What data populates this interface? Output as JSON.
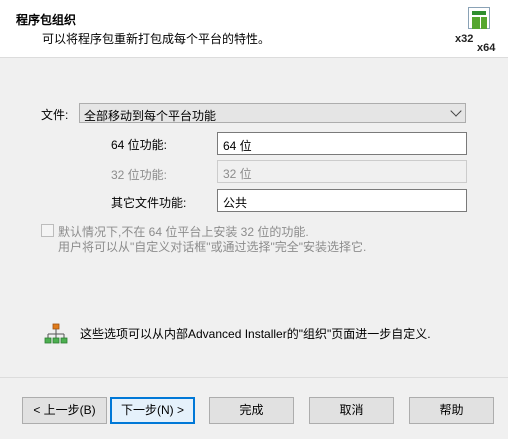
{
  "header": {
    "title": "程序包组织",
    "subtitle": "可以将程序包重新打包成每个平台的特性。",
    "logo_label_32": "x32",
    "logo_label_64": "x64"
  },
  "form": {
    "file_label": "文件:",
    "file_select_value": "全部移动到每个平台功能",
    "f64_label": "64 位功能:",
    "f64_value": "64 位",
    "f32_label": "32 位功能:",
    "f32_value": "32 位",
    "other_label": "其它文件功能:",
    "other_value": "公共"
  },
  "checkbox": {
    "checked": false,
    "line1": "默认情况下,不在 64 位平台上安装 32 位的功能.",
    "line2": "用户将可以从\"自定义对话框\"或通过选择\"完全\"安装选择它."
  },
  "info": {
    "icon": "feature-tree-icon",
    "text": "这些选项可以从内部Advanced Installer的\"组织\"页面进一步自定义."
  },
  "buttons": {
    "back": "< 上一步(B)",
    "next": "下一步(N) >",
    "finish": "完成",
    "cancel": "取消",
    "help": "帮助"
  }
}
